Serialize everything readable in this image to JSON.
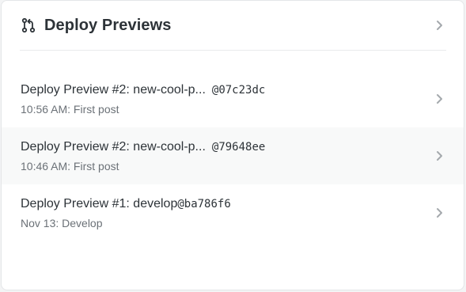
{
  "card": {
    "title": "Deploy Previews",
    "title_icon": "git-pull-request-icon",
    "header_action_icon": "chevron-right-icon"
  },
  "deploys": [
    {
      "name": "Deploy Preview #2",
      "branch": "new-cool-p...",
      "commit": "@07c23dc",
      "time": "10:56 AM",
      "message": "First post",
      "subtitle": "10:56 AM: First post"
    },
    {
      "name": "Deploy Preview #2",
      "branch": "new-cool-p...",
      "commit": "@79648ee",
      "time": "10:46 AM",
      "message": "First post",
      "subtitle": "10:46 AM: First post"
    },
    {
      "name": "Deploy Preview #1",
      "branch": "develop",
      "commit": "@ba786f6",
      "time": "Nov 13",
      "message": "Develop",
      "subtitle": "Nov 13: Develop"
    }
  ],
  "colors": {
    "text_primary": "#2d3338",
    "text_secondary": "#6b7177",
    "row_alt_bg": "#f8f9f9",
    "chevron": "#a4a9ad"
  }
}
